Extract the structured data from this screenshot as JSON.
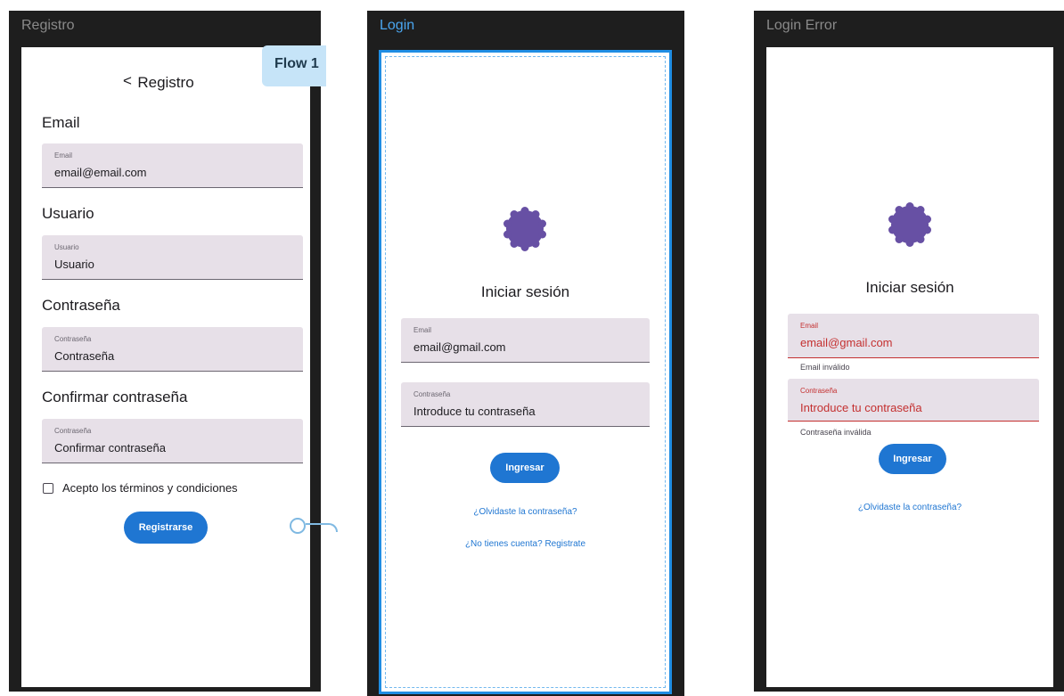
{
  "colors": {
    "primary": "#1f76d2",
    "logo": "#6750a4",
    "error": "#c43030",
    "field_bg": "#e7e0e8",
    "selection": "#1f8de3"
  },
  "frames": {
    "registro": {
      "title": "Registro",
      "header_title": "Registro",
      "back_icon": "chevron-left-icon",
      "back_glyph": "<",
      "email_section": "Email",
      "email_label": "Email",
      "email_value": "email@email.com",
      "user_section": "Usuario",
      "user_label": "Usuario",
      "user_value": "Usuario",
      "password_section": "Contraseña",
      "password_label": "Contraseña",
      "password_value": "Contraseña",
      "confirm_section": "Confirmar contraseña",
      "confirm_label": "Contraseña",
      "confirm_value": "Confirmar contraseña",
      "terms_label": "Acepto los términos y condiciones",
      "submit_label": "Registrarse"
    },
    "login": {
      "title": "Login",
      "logo_icon": "scalloped-badge-icon",
      "heading": "Iniciar sesión",
      "email_label": "Email",
      "email_value": "email@gmail.com",
      "password_label": "Contraseña",
      "password_value": "Introduce tu contraseña",
      "submit_label": "Ingresar",
      "forgot_link": "¿Olvidaste la contraseña?",
      "register_link": "¿No tienes cuenta? Registrate"
    },
    "login_error": {
      "title": "Login Error",
      "logo_icon": "scalloped-badge-icon",
      "heading": "Iniciar sesión",
      "email_label": "Email",
      "email_value": "email@gmail.com",
      "email_error": "Email inválido",
      "password_label": "Contraseña",
      "password_value": "Introduce tu contraseña",
      "password_error": "Contraseña inválida",
      "submit_label": "Ingresar",
      "forgot_link": "¿Olvidaste la contraseña?"
    }
  },
  "flow": {
    "label": "Flow 1"
  }
}
